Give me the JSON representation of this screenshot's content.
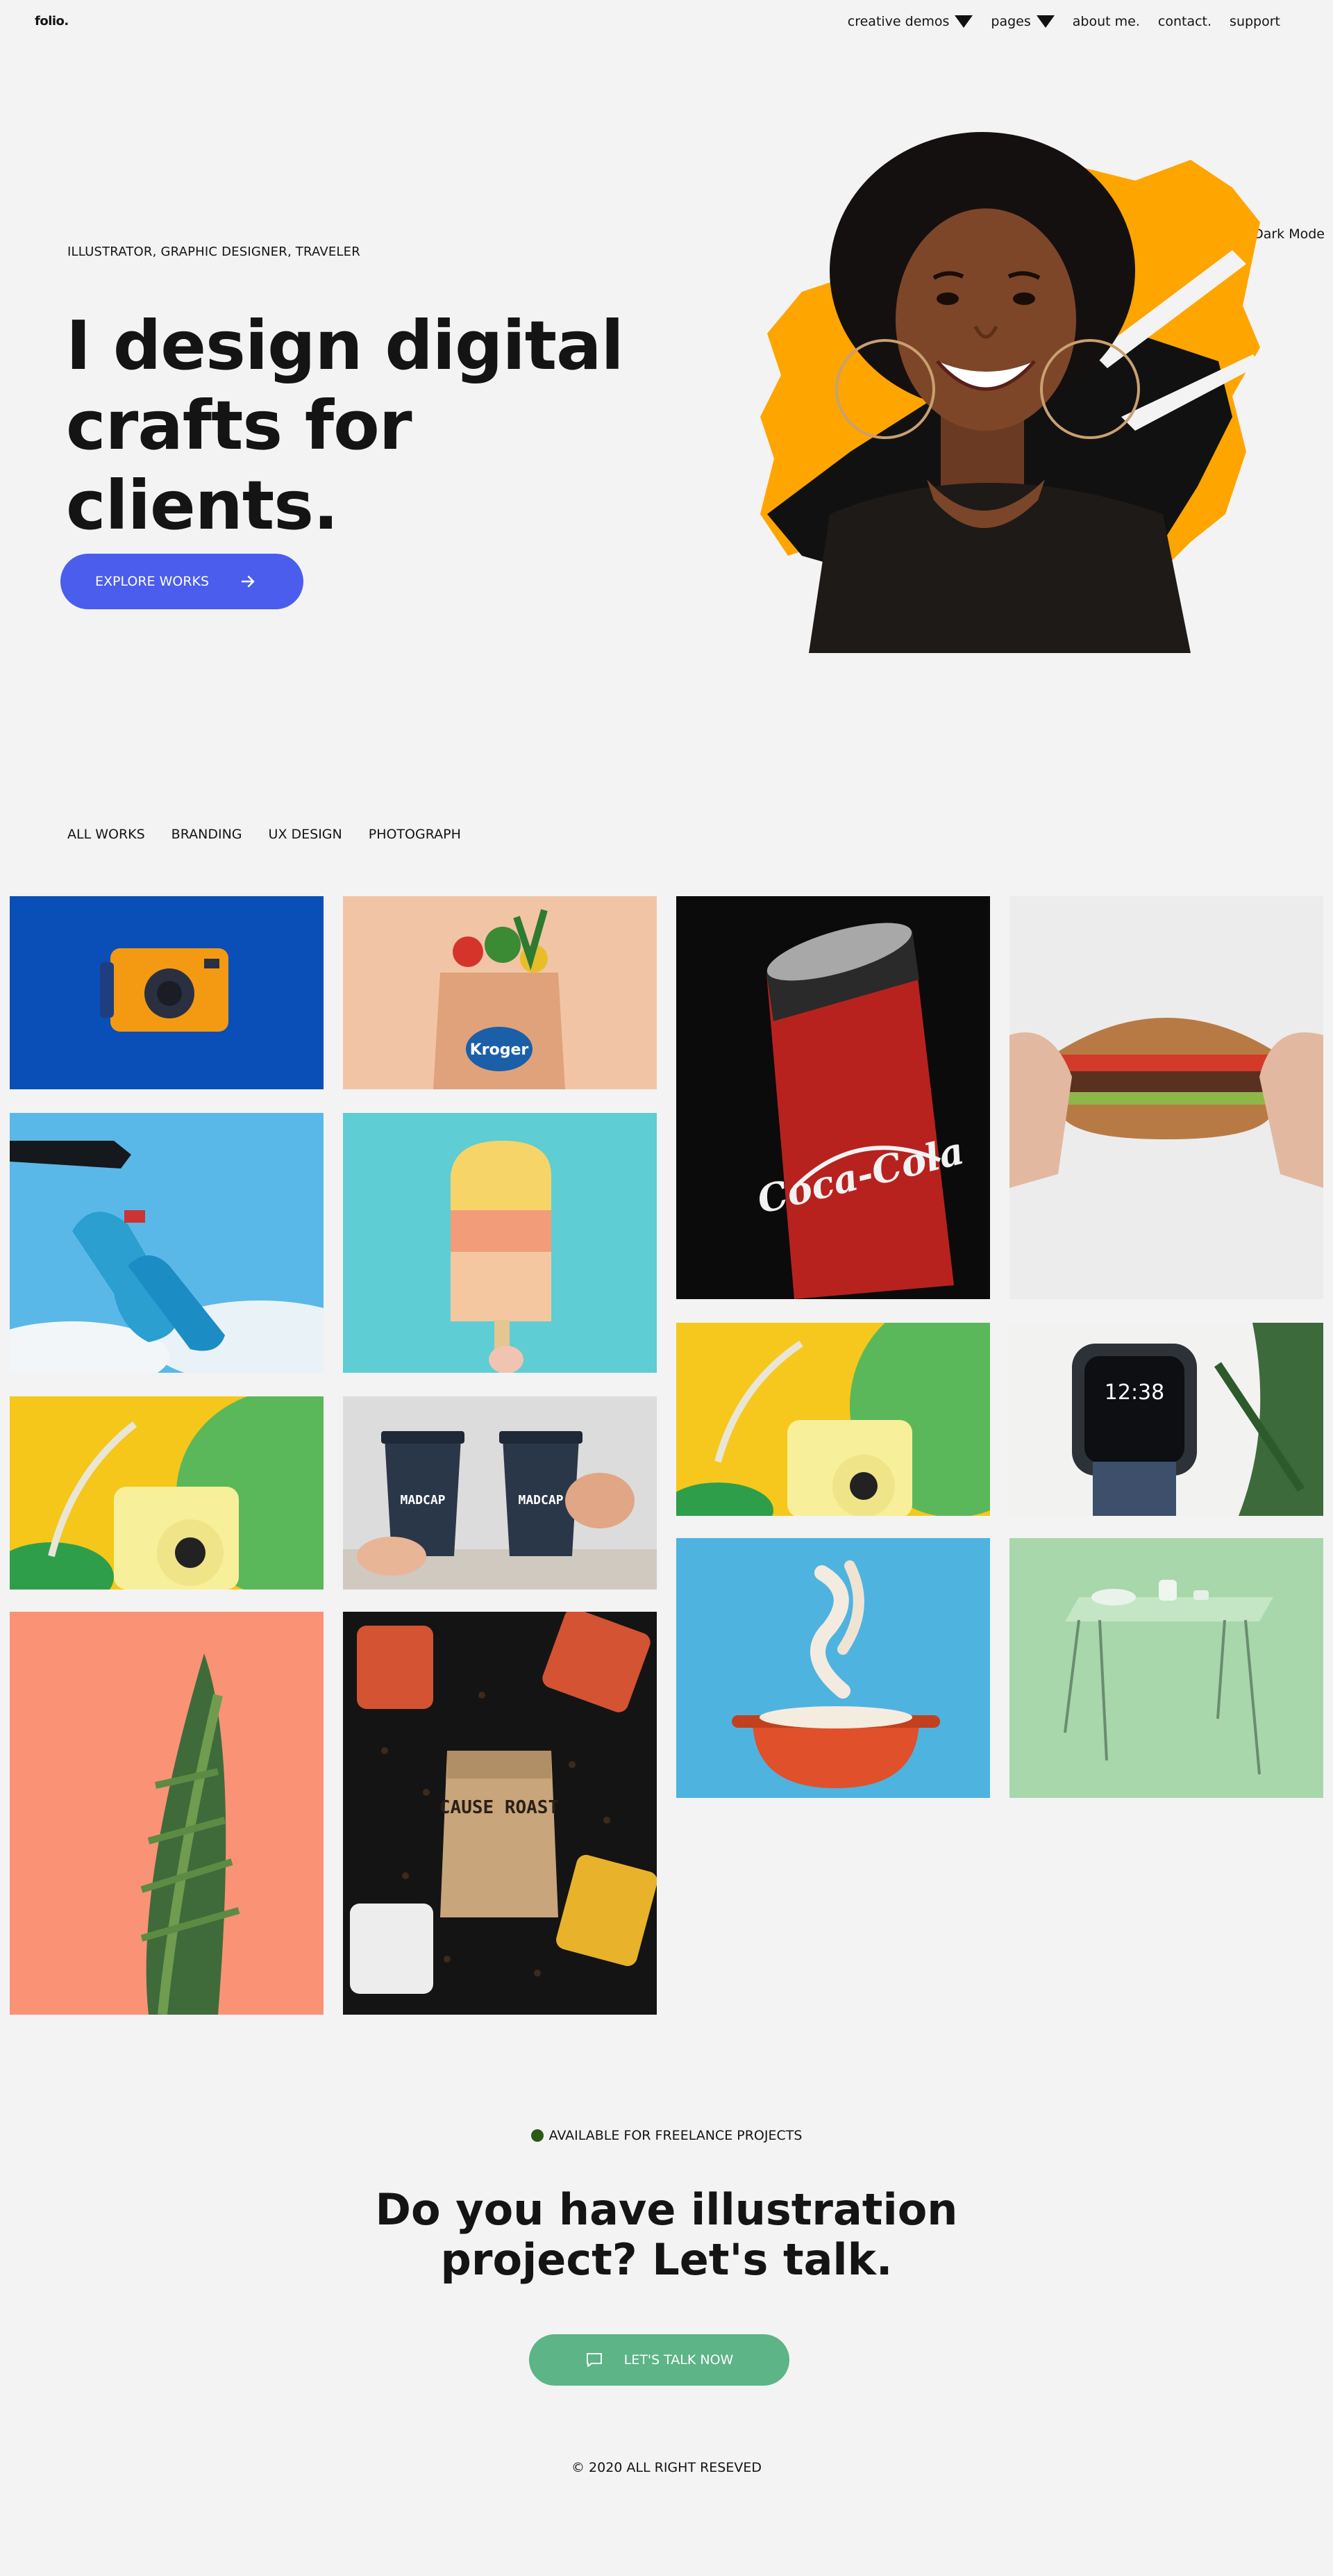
{
  "brand": {
    "logo": "folio."
  },
  "nav": {
    "items": [
      {
        "label": "creative demos",
        "dropdown": true
      },
      {
        "label": "pages",
        "dropdown": true
      },
      {
        "label": "about me.",
        "dropdown": false
      },
      {
        "label": "contact.",
        "dropdown": false
      },
      {
        "label": "support",
        "dropdown": false
      }
    ],
    "dark_mode_label": "Dark Mode"
  },
  "hero": {
    "eyebrow": "ILLUSTRATOR, GRAPHIC DESIGNER, TRAVELER",
    "headline_line1": "I design digital",
    "headline_line2": "crafts for clients.",
    "cta_label": "EXPLORE WORKS",
    "accent_color": "#4b5ded",
    "brush_color": "#ffa500"
  },
  "filters": {
    "items": [
      "ALL WORKS",
      "BRANDING",
      "UX DESIGN",
      "PHOTOGRAPH"
    ]
  },
  "gallery": {
    "tiles": [
      {
        "name": "orange-camera",
        "text": ""
      },
      {
        "name": "kroger-grocery-bag",
        "text": "Kroger"
      },
      {
        "name": "coca-cola-can",
        "text": "Coca-Cola"
      },
      {
        "name": "burger-hands",
        "text": ""
      },
      {
        "name": "blue-sneakers-sky",
        "text": ""
      },
      {
        "name": "popsicle",
        "text": ""
      },
      {
        "name": "yellow-instax-camera",
        "text": ""
      },
      {
        "name": "smartwatch-plant",
        "text": "12:38"
      },
      {
        "name": "instax-camera-leaves",
        "text": ""
      },
      {
        "name": "madcap-coffee-cups",
        "text": "MADCAP"
      },
      {
        "name": "noodles-pot",
        "text": ""
      },
      {
        "name": "mint-table",
        "text": ""
      },
      {
        "name": "plant-on-peach",
        "text": ""
      },
      {
        "name": "cause-roast-coffee",
        "text": "CAUSE ROAST"
      }
    ]
  },
  "contact": {
    "availability": "AVAILABLE FOR FREELANCE PROJECTS",
    "question_line1": "Do you have illustration",
    "question_line2": "project? Let's talk.",
    "cta_label": "LET'S TALK NOW",
    "cta_color": "#5cb487",
    "status_color": "#2b5a12"
  },
  "footer": {
    "copyright": "© 2020 ALL RIGHT RESEVED"
  }
}
